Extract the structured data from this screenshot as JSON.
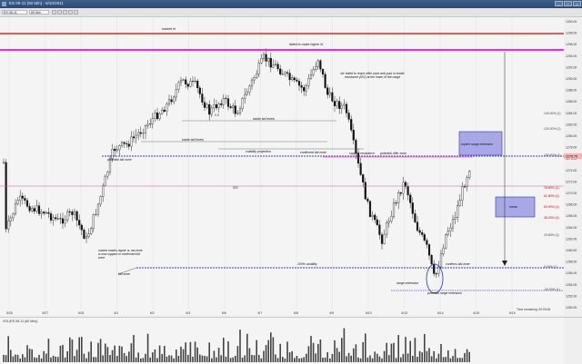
{
  "window": {
    "title": "ES 06-11 (60 Min) - 6/10/2011",
    "buttons": [
      "–",
      "□",
      "×"
    ]
  },
  "toolbar": {
    "instrument": "ES 06-11",
    "interval": "60 Min"
  },
  "chart": {
    "price_axis_labels": [
      "1300.00",
      "1298.00",
      "1296.00",
      "1294.00",
      "1292.00",
      "1290.00",
      "1288.00",
      "1286.00",
      "1284.00",
      "1282.00",
      "1280.00",
      "1278.00",
      "1276.00",
      "1274.00",
      "1272.00",
      "1270.00",
      "1268.00",
      "1266.00",
      "1264.00",
      "1262.00",
      "1260.00",
      "1258.00",
      "1256.00",
      "1254.00",
      "1252.00",
      "1250.00"
    ],
    "date_labels": [
      "5/25",
      "5/27",
      "5/31",
      "6/1",
      "6/2",
      "6/3",
      "6/6",
      "6/7",
      "6/8",
      "6/9",
      "6/10",
      "6/13",
      "6/14",
      "6/15",
      "6/16"
    ],
    "fib_labels": [
      "140.00% (1)",
      "120.00% (1)",
      "100.00% (1)",
      "78.60% (1)",
      "61.80% (1)",
      "50.00% (1)",
      "38.20% (1)",
      "23.60% (1)",
      "0.00% (1)",
      "-20.00% (1)"
    ],
    "current_price": "1275.75",
    "annotations": {
      "market_hi": "market hi",
      "failed_higher": "failed to make higher hi",
      "failed_reach": "b/c failed to reach offer zone and puts in inside resistance (IR2) at the lower of the range",
      "inside_bid_levels_1": "inside bid levels",
      "inside_bid_levels_2": "inside bid levels",
      "volatility_projection": "volatility projection",
      "confirmed_bid_zone": "confirmed bid zone",
      "support_resistance": "support resistance",
      "potential_offer_zone": "potential offer zone",
      "potential_bid_zone": "potential bid zone",
      "expect_range_extension": "expect range extension",
      "mean": "mean",
      "market_makes": "market makes higher hi, bid zone is now support or confirmed bid zone",
      "bid_zone": "bid zone",
      "volatility_100": "100% volatility",
      "confirms_bid_zone": "confirms bid zone",
      "range_extension": "range extension",
      "potential_range_extension": "potential range extension",
      "x0_5": "0.5",
      "line_label": "S/R"
    },
    "time_remaining": "Time remaining: 00:00:00"
  },
  "volume": {
    "label": "VOL(ES 06-11 (60 Min))"
  },
  "colors": {
    "red_line": "#d40000",
    "magenta_line": "#ff00ff",
    "blue_dashed": "#0000cc",
    "up_candle": "#f5f5f5",
    "down_candle": "#111111",
    "box_fill": "#8f8fe6",
    "box_stroke": "#3333aa"
  }
}
